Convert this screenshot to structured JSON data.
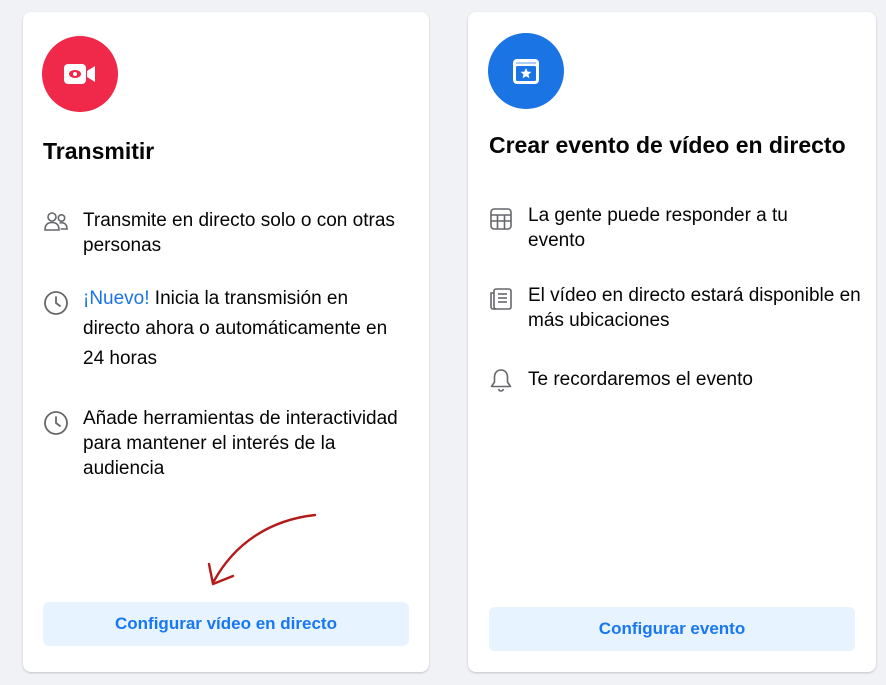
{
  "cards": [
    {
      "id": "live",
      "icon": "video-camera-icon",
      "icon_color": "#f02849",
      "title": "Transmitir",
      "features": [
        {
          "icon": "people-icon",
          "highlight": "",
          "text": "Transmite en directo solo o con otras personas"
        },
        {
          "icon": "clock-icon",
          "highlight": "¡Nuevo!",
          "text": " Inicia la transmisión en directo ahora o automáticamente en 24 horas"
        },
        {
          "icon": "clock-icon",
          "highlight": "",
          "text": "Añade herramientas de interactividad para mantener el interés de la audiencia"
        }
      ],
      "button_label": "Configurar vídeo en directo"
    },
    {
      "id": "event",
      "icon": "calendar-star-icon",
      "icon_color": "#1b74e4",
      "title": "Crear evento de vídeo en directo",
      "features": [
        {
          "icon": "calendar-grid-icon",
          "text": "La gente puede responder a tu evento"
        },
        {
          "icon": "newsfeed-icon",
          "text": "El vídeo en directo estará disponible en más ubicaciones"
        },
        {
          "icon": "bell-icon",
          "text": "Te recordaremos el evento"
        }
      ],
      "button_label": "Configurar evento"
    }
  ],
  "annotation": {
    "arrow_color": "#b31b1b"
  },
  "colors": {
    "accent": "#1877f2",
    "button_bg": "#e7f3ff",
    "page_bg": "#f0f2f5"
  }
}
